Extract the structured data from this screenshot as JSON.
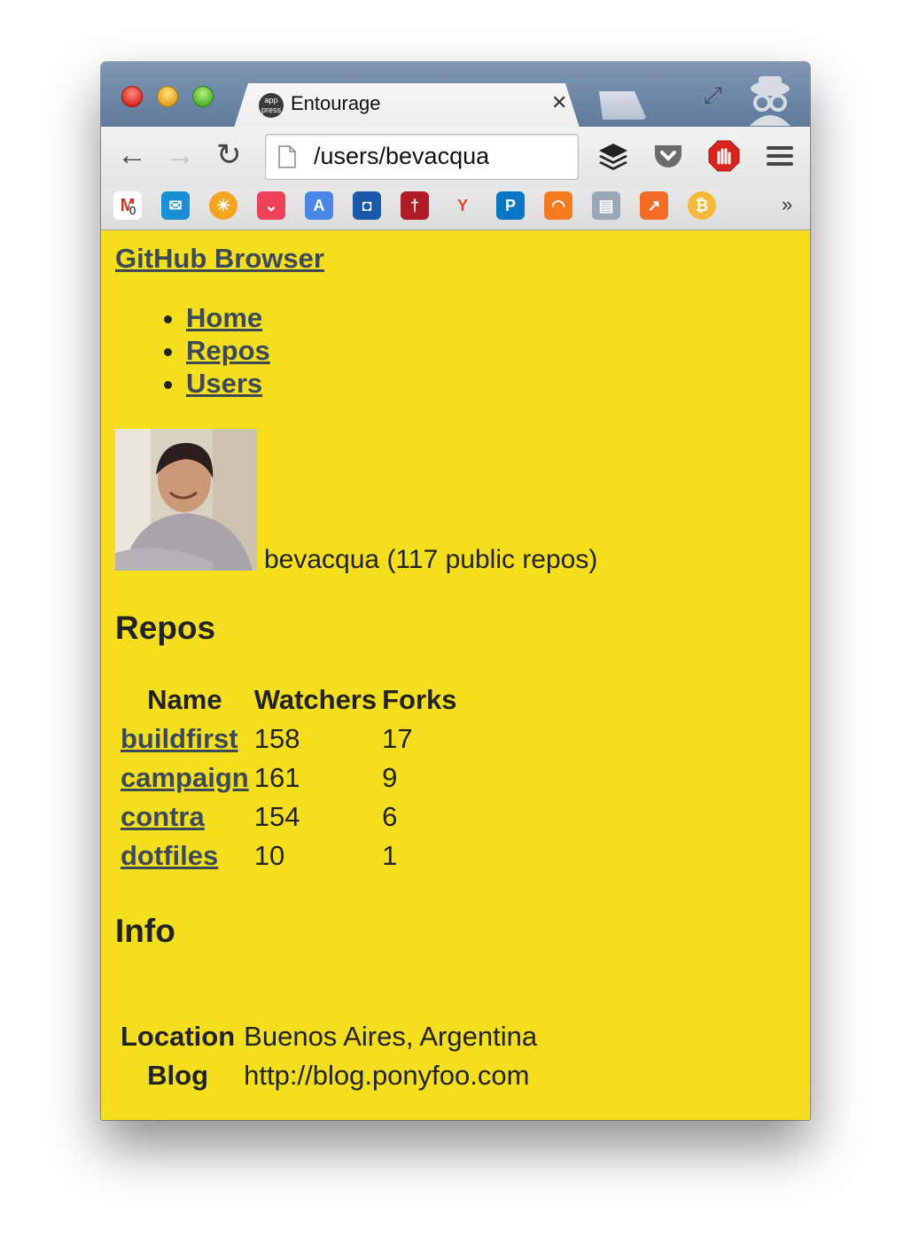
{
  "browser": {
    "tab": {
      "title": "Entourage",
      "favicon_text": "app press"
    },
    "omnibox": {
      "url": "/users/bevacqua"
    },
    "bookmarks_more": "»",
    "extensions": [
      "buffer-icon",
      "pocket-icon",
      "adblock-icon",
      "menu-icon"
    ],
    "bookmarks": [
      "gmail-icon",
      "twitter-icon",
      "sun-icon",
      "pocket-icon",
      "translate-icon",
      "chase-icon",
      "dagger-icon",
      "yammer-icon",
      "paypal-icon",
      "grooveshark-icon",
      "devtools-icon",
      "analytics-icon",
      "bitcoin-icon"
    ],
    "gmail_badge": "0"
  },
  "page": {
    "brand": "GitHub Browser",
    "nav": [
      "Home",
      "Repos",
      "Users"
    ],
    "user": {
      "summary": "bevacqua (117 public repos)"
    },
    "repos_heading": "Repos",
    "repo_columns": [
      "Name",
      "Watchers",
      "Forks"
    ],
    "repos": [
      {
        "name": "buildfirst",
        "watchers": "158",
        "forks": "17"
      },
      {
        "name": "campaign",
        "watchers": "161",
        "forks": "9"
      },
      {
        "name": "contra",
        "watchers": "154",
        "forks": "6"
      },
      {
        "name": "dotfiles",
        "watchers": "10",
        "forks": "1"
      }
    ],
    "info_heading": "Info",
    "info": {
      "location_label": "Location",
      "location_value": "Buenos Aires, Argentina",
      "blog_label": "Blog",
      "blog_value": "http://blog.ponyfoo.com"
    }
  },
  "colors": {
    "page_bg": "#f5de1e",
    "link": "#3c4a58",
    "titlebar": "#6f88a7"
  }
}
